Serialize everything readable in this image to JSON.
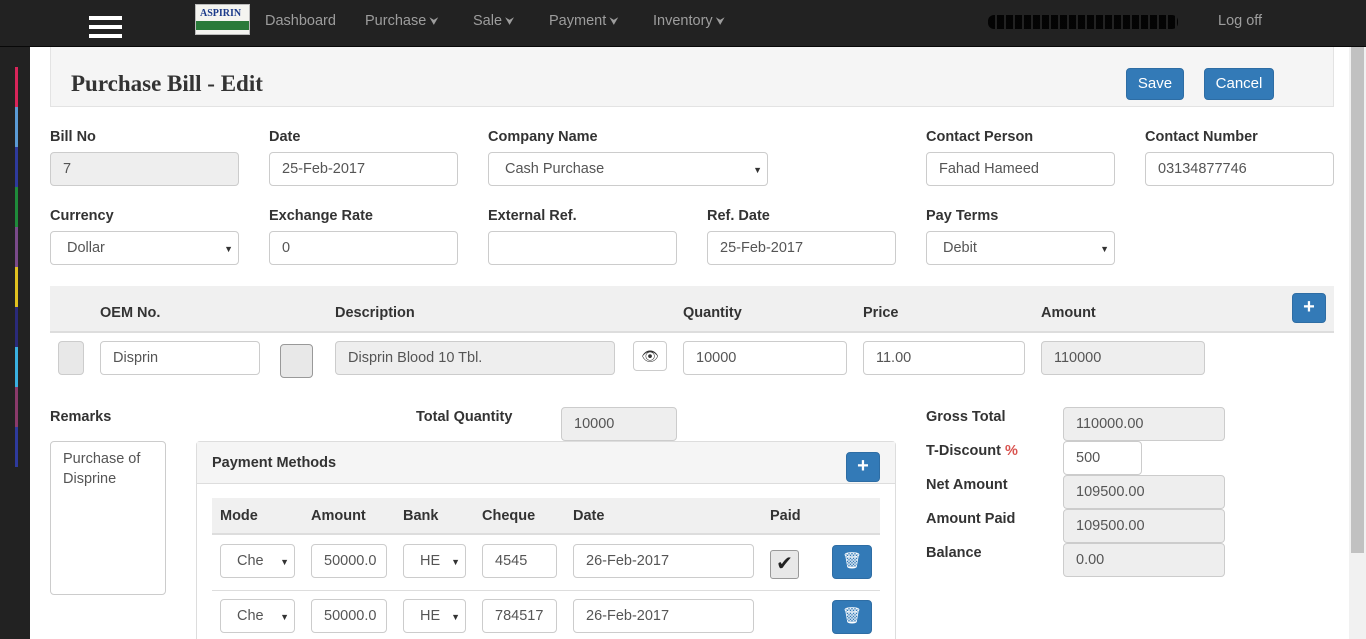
{
  "nav": {
    "logo_text": "ASPIRIN",
    "items": [
      {
        "label": "Dashboard",
        "chevron": false
      },
      {
        "label": "Purchase",
        "chevron": true
      },
      {
        "label": "Sale",
        "chevron": true
      },
      {
        "label": "Payment",
        "chevron": true
      },
      {
        "label": "Inventory",
        "chevron": true
      }
    ],
    "logoff": "Log off"
  },
  "page": {
    "title": "Purchase Bill - Edit",
    "save": "Save",
    "cancel": "Cancel"
  },
  "form": {
    "bill_no": {
      "label": "Bill No",
      "value": "7"
    },
    "date": {
      "label": "Date",
      "value": "25-Feb-2017"
    },
    "company": {
      "label": "Company Name",
      "value": "Cash Purchase"
    },
    "contact_person": {
      "label": "Contact Person",
      "value": "Fahad Hameed"
    },
    "contact_number": {
      "label": "Contact Number",
      "value": "03134877746"
    },
    "currency": {
      "label": "Currency",
      "value": "Dollar"
    },
    "exchange_rate": {
      "label": "Exchange Rate",
      "value": "0"
    },
    "external_ref": {
      "label": "External Ref.",
      "value": ""
    },
    "ref_date": {
      "label": "Ref. Date",
      "value": "25-Feb-2017"
    },
    "pay_terms": {
      "label": "Pay Terms",
      "value": "Debit"
    }
  },
  "items_table": {
    "headers": {
      "oem": "OEM No.",
      "description": "Description",
      "quantity": "Quantity",
      "price": "Price",
      "amount": "Amount"
    },
    "row": {
      "oem": "Disprin",
      "description": "Disprin Blood 10 Tbl.",
      "quantity": "10000",
      "price": "11.00",
      "amount": "110000"
    }
  },
  "summary": {
    "remarks_label": "Remarks",
    "remarks": "Purchase of Disprine",
    "total_quantity_label": "Total Quantity",
    "total_quantity": "10000",
    "gross_total_label": "Gross Total",
    "gross_total": "110000.00",
    "t_discount_label": "T-Discount",
    "t_discount_pct": "%",
    "t_discount": "500",
    "net_amount_label": "Net Amount",
    "net_amount": "109500.00",
    "amount_paid_label": "Amount Paid",
    "amount_paid": "109500.00",
    "balance_label": "Balance",
    "balance": "0.00"
  },
  "payment_methods": {
    "title": "Payment Methods",
    "headers": {
      "mode": "Mode",
      "amount": "Amount",
      "bank": "Bank",
      "cheque": "Cheque",
      "date": "Date",
      "paid": "Paid"
    },
    "rows": [
      {
        "mode": "Che",
        "amount": "50000.0",
        "bank": "HE",
        "cheque": "4545",
        "date": "26-Feb-2017",
        "paid": true
      },
      {
        "mode": "Che",
        "amount": "50000.0",
        "bank": "HE",
        "cheque": "784517",
        "date": "26-Feb-2017",
        "paid": false
      }
    ]
  },
  "colors": {
    "primary": "#337ab7",
    "navbar": "#222222",
    "discount_pct": "#d9534f"
  }
}
